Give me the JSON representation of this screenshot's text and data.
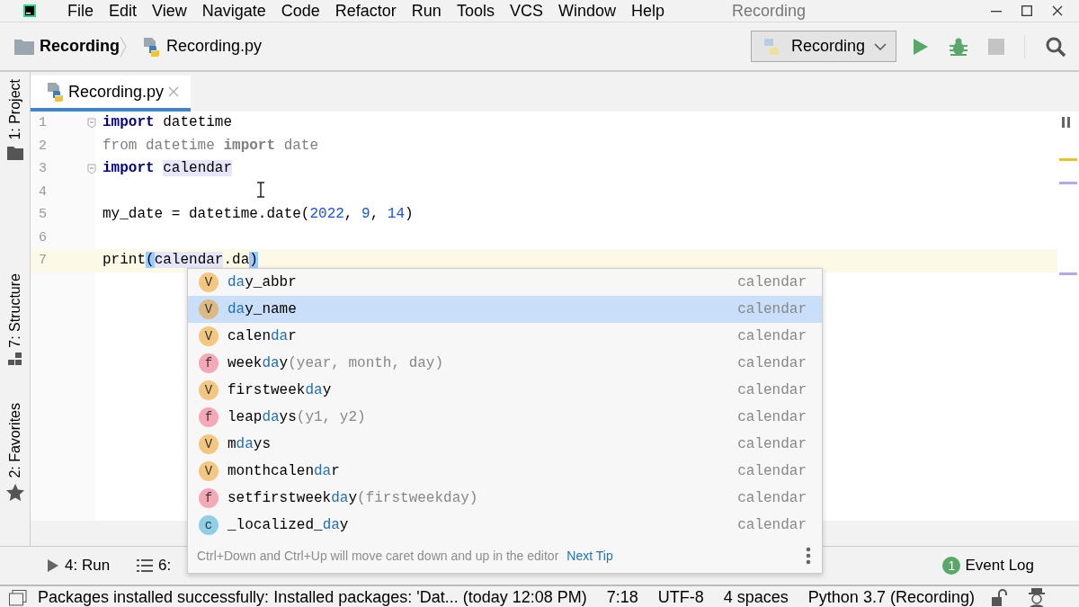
{
  "window": {
    "title": "Recording"
  },
  "menu": [
    "File",
    "Edit",
    "View",
    "Navigate",
    "Code",
    "Refactor",
    "Run",
    "Tools",
    "VCS",
    "Window",
    "Help"
  ],
  "breadcrumbs": [
    {
      "label": "Recording",
      "kind": "folder"
    },
    {
      "label": "Recording.py",
      "kind": "python-file"
    }
  ],
  "run_config": {
    "label": "Recording"
  },
  "toolbar": [
    {
      "kind": "run",
      "disabled": false
    },
    {
      "kind": "debug",
      "disabled": false
    },
    {
      "kind": "stop",
      "disabled": true
    }
  ],
  "side_tabs": [
    {
      "label": "1: Project",
      "kind": "folder"
    },
    {
      "label": "7: Structure",
      "kind": "structure"
    },
    {
      "label": "2: Favorites",
      "kind": "star"
    }
  ],
  "editor_tabs": [
    {
      "label": "Recording.py",
      "selected": true
    }
  ],
  "code_lines": [
    {
      "number": "1",
      "fold": true,
      "current": false,
      "tokens": [
        {
          "t": "import ",
          "kind": "kw"
        },
        {
          "t": "datetime",
          "kind": "id"
        }
      ]
    },
    {
      "number": "2",
      "fold": false,
      "current": false,
      "tokens": [
        {
          "t": "from datetime ",
          "kind": "unused"
        },
        {
          "t": "import",
          "kind": "unused-kw"
        },
        {
          "t": " date",
          "kind": "unused"
        }
      ]
    },
    {
      "number": "3",
      "fold": true,
      "current": false,
      "tokens": [
        {
          "t": "import ",
          "kind": "kw"
        },
        {
          "t": "calendar",
          "kind": "usage"
        }
      ]
    },
    {
      "number": "4",
      "fold": false,
      "current": false
    },
    {
      "number": "5",
      "fold": false,
      "current": false,
      "tokens": [
        {
          "t": "my_date = datetime.date(",
          "kind": "id"
        },
        {
          "t": "2022",
          "kind": "num"
        },
        {
          "t": ", ",
          "kind": "id"
        },
        {
          "t": "9",
          "kind": "num"
        },
        {
          "t": ", ",
          "kind": "id"
        },
        {
          "t": "14",
          "kind": "num"
        },
        {
          "t": ")",
          "kind": "id"
        }
      ]
    },
    {
      "number": "6",
      "fold": false,
      "current": false
    },
    {
      "number": "7",
      "fold": false,
      "current": true,
      "tokens": [
        {
          "t": "print",
          "kind": "id"
        },
        {
          "t": "(",
          "kind": "brace"
        },
        {
          "t": "calendar",
          "kind": "usage"
        },
        {
          "t": ".da",
          "kind": "id"
        },
        {
          "t": ")",
          "kind": "brace"
        }
      ]
    }
  ],
  "completion": {
    "items": [
      {
        "kind": "v",
        "letter": "V",
        "selected": false,
        "name": [
          {
            "text": "da",
            "match": true
          },
          {
            "text": "y_abbr",
            "match": false
          }
        ],
        "origin": "calendar"
      },
      {
        "kind": "v",
        "letter": "V",
        "selected": true,
        "name": [
          {
            "text": "da",
            "match": true
          },
          {
            "text": "y_name",
            "match": false
          }
        ],
        "origin": "calendar"
      },
      {
        "kind": "v",
        "letter": "V",
        "selected": false,
        "name": [
          {
            "text": "calen",
            "match": false
          },
          {
            "text": "da",
            "match": true
          },
          {
            "text": "r",
            "match": false
          }
        ],
        "origin": "calendar"
      },
      {
        "kind": "f",
        "letter": "f",
        "selected": false,
        "name": [
          {
            "text": "week",
            "match": false
          },
          {
            "text": "da",
            "match": true
          },
          {
            "text": "y",
            "match": false
          }
        ],
        "params": "(year, month, day)",
        "origin": "calendar"
      },
      {
        "kind": "v",
        "letter": "V",
        "selected": false,
        "name": [
          {
            "text": "firstweek",
            "match": false
          },
          {
            "text": "da",
            "match": true
          },
          {
            "text": "y",
            "match": false
          }
        ],
        "origin": "calendar"
      },
      {
        "kind": "f",
        "letter": "f",
        "selected": false,
        "name": [
          {
            "text": "leap",
            "match": false
          },
          {
            "text": "da",
            "match": true
          },
          {
            "text": "ys",
            "match": false
          }
        ],
        "params": "(y1, y2)",
        "origin": "calendar"
      },
      {
        "kind": "v",
        "letter": "V",
        "selected": false,
        "name": [
          {
            "text": "m",
            "match": false
          },
          {
            "text": "da",
            "match": true
          },
          {
            "text": "ys",
            "match": false
          }
        ],
        "origin": "calendar"
      },
      {
        "kind": "v",
        "letter": "V",
        "selected": false,
        "name": [
          {
            "text": "monthcalen",
            "match": false
          },
          {
            "text": "da",
            "match": true
          },
          {
            "text": "r",
            "match": false
          }
        ],
        "origin": "calendar"
      },
      {
        "kind": "f",
        "letter": "f",
        "selected": false,
        "name": [
          {
            "text": "setfirstweek",
            "match": false
          },
          {
            "text": "da",
            "match": true
          },
          {
            "text": "y",
            "match": false
          }
        ],
        "params": "(firstweekday)",
        "origin": "calendar"
      },
      {
        "kind": "c",
        "letter": "c",
        "selected": false,
        "name": [
          {
            "text": "_localized_",
            "match": false
          },
          {
            "text": "da",
            "match": true
          },
          {
            "text": "y",
            "match": false
          }
        ],
        "origin": "calendar"
      }
    ],
    "tip": "Ctrl+Down and Ctrl+Up will move caret down and up in the editor",
    "tip_link": "Next Tip"
  },
  "bottom_tools": [
    {
      "label": "4: Run",
      "kind": "run"
    },
    {
      "label": "6:",
      "kind": "list"
    }
  ],
  "event_log": {
    "label": "Event Log",
    "count": "1"
  },
  "status_bar": {
    "message": "Packages installed successfully: Installed packages: 'Dat... (today 12:08 PM)",
    "position": "7:18",
    "encoding": "UTF-8",
    "indent": "4 spaces",
    "interpreter": "Python 3.7 (Recording)"
  }
}
